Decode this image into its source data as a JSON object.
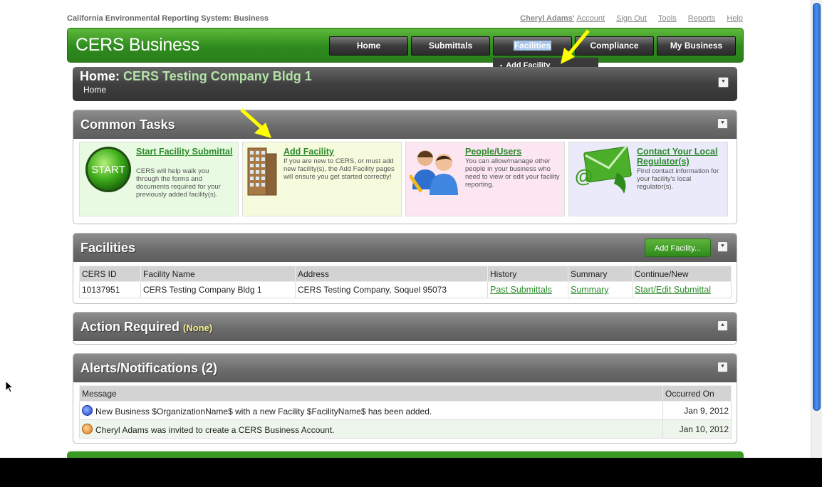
{
  "system_name": "California Environmental Reporting System: Business",
  "top_links": {
    "user_name": "Cheryl Adams'",
    "account": "Account",
    "sign_out": "Sign Out",
    "tools": "Tools",
    "reports": "Reports",
    "help": "Help"
  },
  "brand": "CERS Business",
  "nav": {
    "home": "Home",
    "submittals": "Submittals",
    "facilities": "Facilities",
    "compliance": "Compliance",
    "my_business": "My Business"
  },
  "facilities_dropdown": {
    "add_facility": "Add Facility"
  },
  "breadcrumb_panel": {
    "prefix": "Home:",
    "company": "CERS Testing Company Bldg 1",
    "crumb": "Home"
  },
  "common_tasks": {
    "title": "Common Tasks",
    "start": {
      "icon_text": "START",
      "title": "Start Facility Submittal",
      "desc": "CERS will help walk you through the forms and documents required for your previously added facility(s)."
    },
    "add_facility": {
      "title": "Add Facility",
      "desc": "If you are new to CERS, or must add new facility(s), the Add Facility pages will ensure you get started correctly!"
    },
    "people": {
      "title": "People/Users",
      "desc": "You can allow/manage other people in your business who need to view or edit your facility reporting."
    },
    "contact": {
      "title": "Contact Your Local Regulator(s)",
      "desc": "Find contact information for your facility's local regulator(s)."
    }
  },
  "facilities_panel": {
    "title": "Facilities",
    "add_button": "Add Facility...",
    "columns": [
      "CERS ID",
      "Facility Name",
      "Address",
      "History",
      "Summary",
      "Continue/New"
    ],
    "row": {
      "cers_id": "10137951",
      "name": "CERS Testing Company Bldg 1",
      "address": "CERS Testing Company, Soquel 95073",
      "history": "Past Submittals",
      "summary": "Summary",
      "continue": "Start/Edit Submittal"
    }
  },
  "action_required": {
    "title": "Action Required",
    "status": "(None)"
  },
  "alerts": {
    "title": "Alerts/Notifications (2)",
    "columns": [
      "Message",
      "Occurred On"
    ],
    "rows": [
      {
        "message": "New Business $OrganizationName$ with a new Facility $FacilityName$ has been added.",
        "date": "Jan 9, 2012",
        "icon": "blue-info-icon"
      },
      {
        "message": "Cheryl Adams was invited to create a CERS Business Account.",
        "date": "Jan 10, 2012",
        "icon": "orange-alert-icon"
      }
    ]
  },
  "colors": {
    "brand_green": "#2e8b1e",
    "link_green": "#2b8a2b",
    "arrow_yellow": "#ffff00"
  }
}
